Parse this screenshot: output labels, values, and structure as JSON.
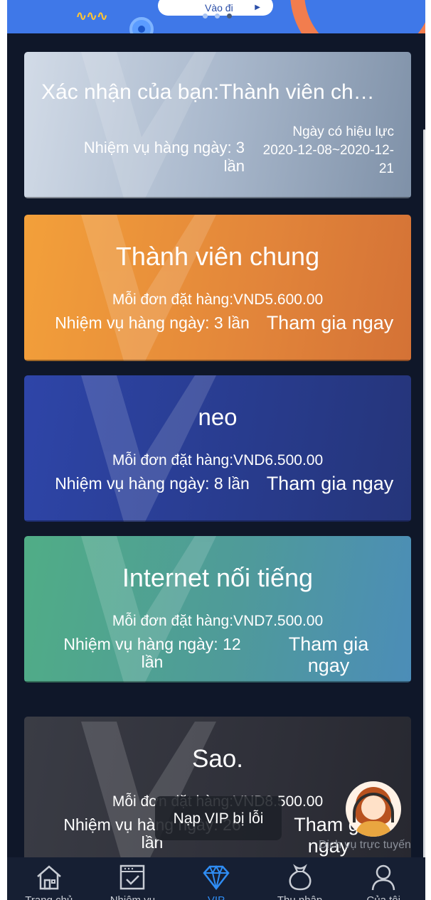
{
  "banner": {
    "button_label": "Vào đi",
    "arrow_icon": "play-arrow-icon",
    "colors": {
      "background": "#3f78e8",
      "accent": "#f27d4e",
      "wave": "#ffc534"
    }
  },
  "current_membership": {
    "title": "Xác nhận của bạn:Thành viên ch…",
    "tasks_line1": "Nhiệm vụ hàng ngày: 3",
    "tasks_line2": "lần",
    "validity_label": "Ngày có hiệu lực",
    "validity_line1": "2020-12-08~2020-12-",
    "validity_line2": "21"
  },
  "levels": [
    {
      "name": "Thành viên chung",
      "price": "Mỗi đơn đặt hàng:VND5.600.00",
      "tasks": "Nhiệm vụ hàng ngày: 3 lần",
      "join": "Tham gia ngay",
      "color": "#e98b38"
    },
    {
      "name": "neo",
      "price": "Mỗi đơn đặt hàng:VND6.500.00",
      "tasks": "Nhiệm vụ hàng ngày: 8 lần",
      "join": "Tham gia ngay",
      "color": "#2b3f98"
    },
    {
      "name": "Internet nối tiếng",
      "price": "Mỗi đơn đặt hàng:VND7.500.00",
      "tasks_line1": "Nhiệm vụ hàng ngày: 12",
      "tasks_line2": "lần",
      "join_line1": "Tham gia",
      "join_line2": "ngay",
      "color": "#4f9d9c"
    },
    {
      "name": "Sao.",
      "price": "Mỗi đơn đặt hàng:VND8.500.00",
      "tasks_line1": "Nhiệm vụ hàng ngày: 26",
      "tasks_line2": "lần",
      "join_line1": "Tham gi",
      "join_line2": "ngay",
      "color": "#30323b"
    }
  ],
  "toast": {
    "message": "Nạp VIP bị lỗi"
  },
  "support": {
    "label": "Dịch vụ trực tuyến",
    "icon": "customer-service-agent-icon"
  },
  "bottom_nav": {
    "items": [
      {
        "label": "Trang chủ",
        "icon": "home-icon"
      },
      {
        "label": "Nhiệm vụ",
        "icon": "task-list-icon"
      },
      {
        "label": "VIP",
        "icon": "diamond-icon",
        "active": true
      },
      {
        "label": "Thu nhập",
        "icon": "money-bag-icon"
      },
      {
        "label": "Của tôi",
        "icon": "user-icon"
      }
    ],
    "active_color": "#2f8df4"
  }
}
